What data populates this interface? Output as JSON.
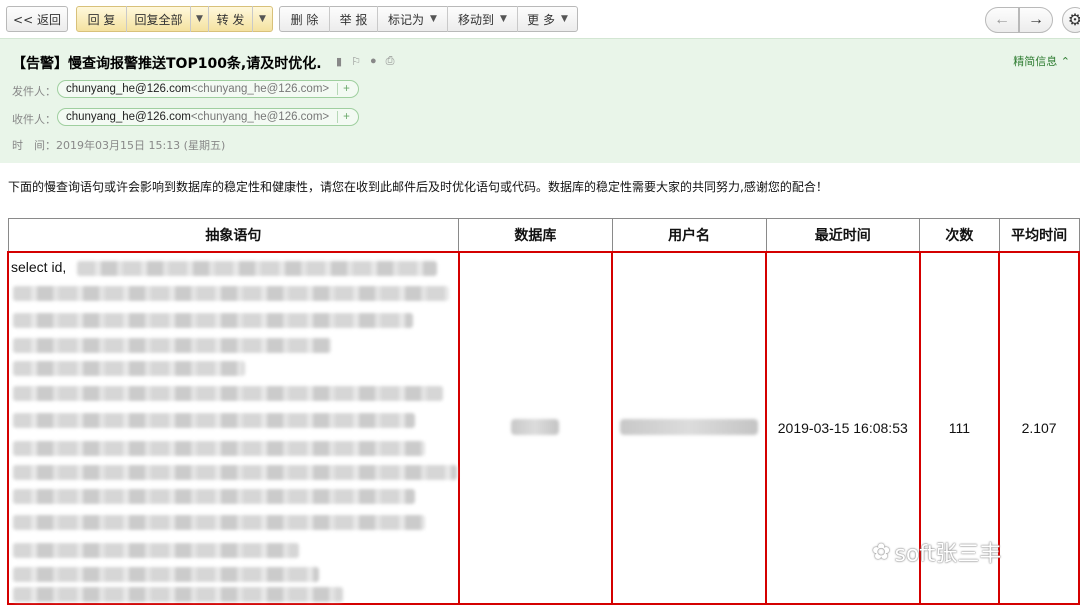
{
  "toolbar": {
    "back": "<< 返回",
    "reply": "回 复",
    "reply_all": "回复全部",
    "forward": "转 发",
    "delete": "删 除",
    "report": "举 报",
    "mark_as": "标记为",
    "move_to": "移动到",
    "more": "更 多"
  },
  "email": {
    "subject": "【告警】慢查询报警推送TOP100条,请及时优化.",
    "brief_info": "精简信息 ⌃",
    "from_label": "发件人：",
    "from_name": "chunyang_he@126.com",
    "from_addr": "<chunyang_he@126.com>",
    "to_label": "收件人：",
    "to_name": "chunyang_he@126.com",
    "to_addr": "<chunyang_he@126.com>",
    "time_label": "时　间：",
    "time_value": "2019年03月15日 15:13 (星期五)",
    "plus": "+"
  },
  "intro": "下面的慢查询语句或许会影响到数据库的稳定性和健康性，请您在收到此邮件后及时优化语句或代码。数据库的稳定性需要大家的共同努力,感谢您的配合！",
  "table": {
    "headers": [
      "抽象语句",
      "数据库",
      "用户名",
      "最近时间",
      "次数",
      "平均时间"
    ],
    "row": {
      "sql_start": "select id,",
      "recent_time": "2019-03-15 16:08:53",
      "count": "111",
      "avg_time": "2.107"
    }
  },
  "watermark": "soft张三丰"
}
